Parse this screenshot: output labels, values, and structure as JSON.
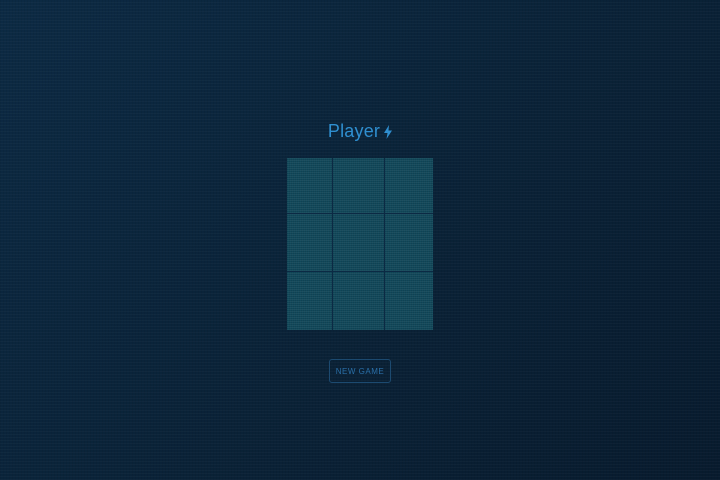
{
  "status": {
    "label": "Player",
    "icon": "lightning-bolt-icon"
  },
  "board": {
    "rows": 3,
    "cols": 3,
    "cells": [
      "",
      "",
      "",
      "",
      "",
      "",
      "",
      "",
      ""
    ]
  },
  "controls": {
    "new_game_label": "NEW GAME"
  },
  "colors": {
    "background": "#0a2237",
    "accent": "#2f8fd0",
    "cell": "#11485a"
  }
}
